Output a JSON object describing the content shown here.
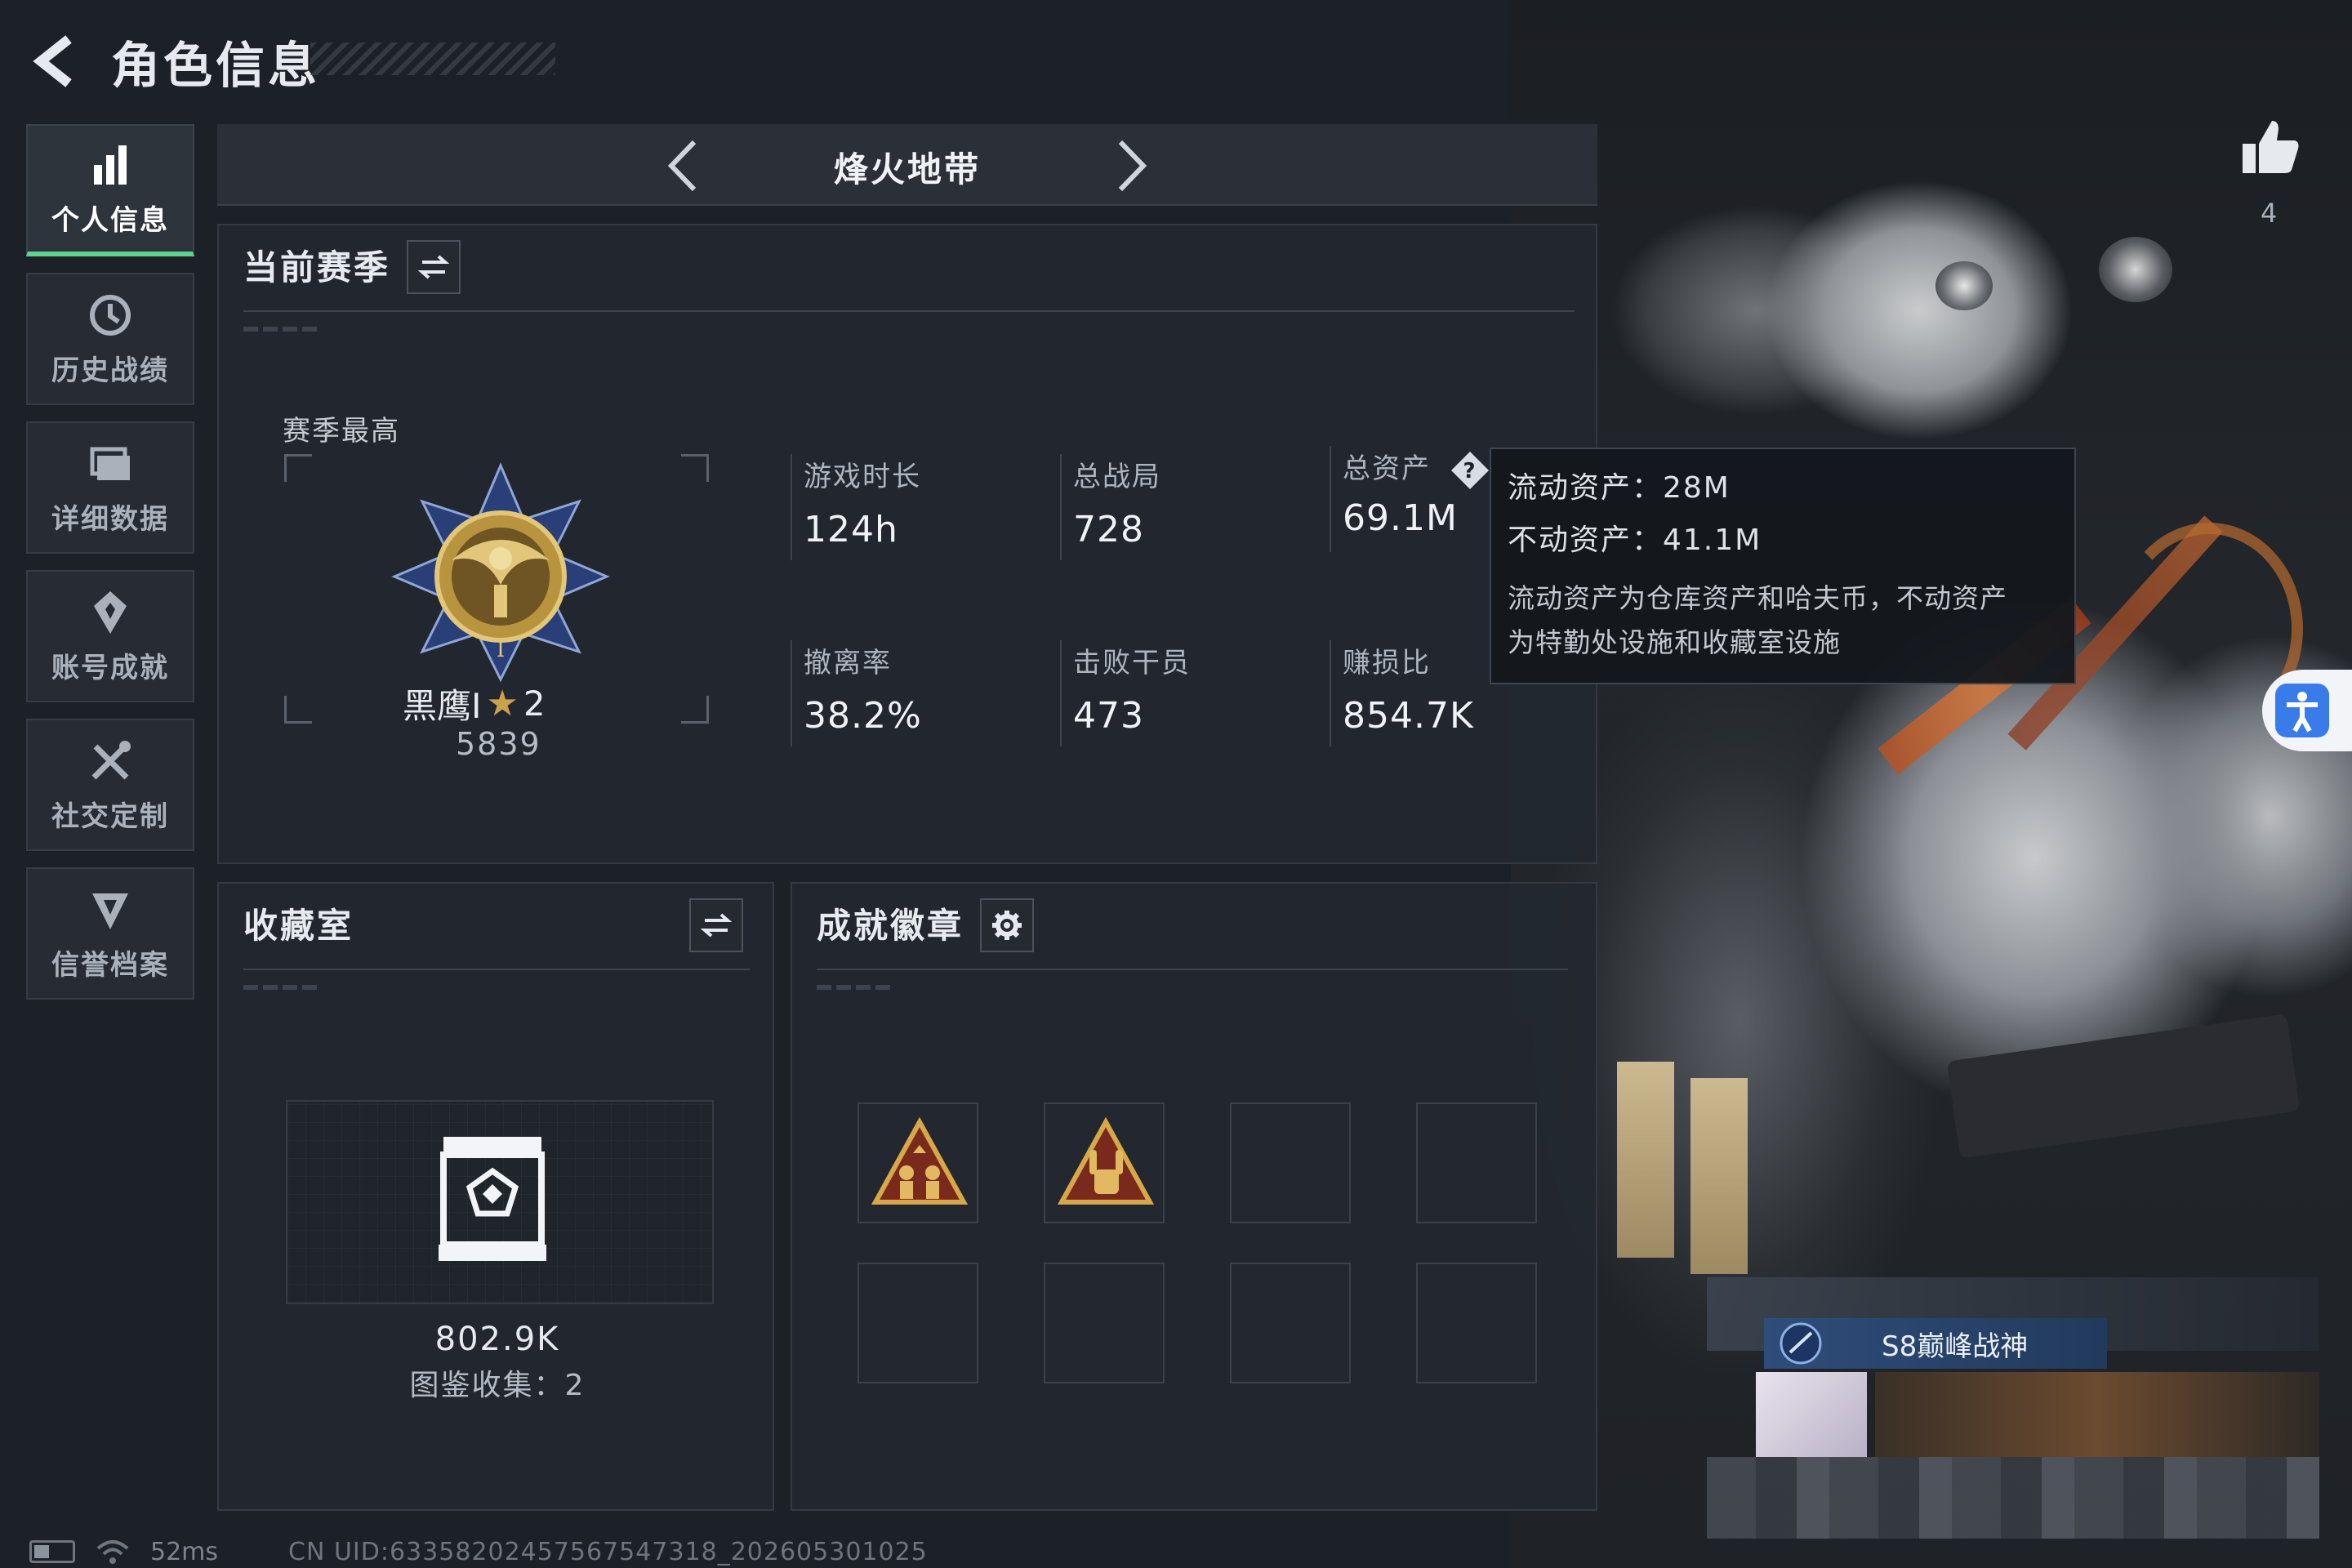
{
  "header": {
    "title": "角色信息"
  },
  "sidebar": {
    "items": [
      {
        "label": "个人信息",
        "icon": "bar-chart-icon",
        "active": true
      },
      {
        "label": "历史战绩",
        "icon": "history-icon"
      },
      {
        "label": "详细数据",
        "icon": "folder-icon"
      },
      {
        "label": "账号成就",
        "icon": "achievement-icon"
      },
      {
        "label": "社交定制",
        "icon": "tools-icon"
      },
      {
        "label": "信誉档案",
        "icon": "shield-icon"
      }
    ]
  },
  "mode": {
    "label": "烽火地带"
  },
  "season": {
    "title": "当前赛季",
    "best_label": "赛季最高",
    "rank_name": "黑鹰I",
    "rank_stars": "2",
    "rank_score": "5839",
    "stats": {
      "playtime": {
        "label": "游戏时长",
        "value": "124h"
      },
      "matches": {
        "label": "总战局",
        "value": "728"
      },
      "assets": {
        "label": "总资产",
        "value": "69.1M"
      },
      "extract_rate": {
        "label": "撤离率",
        "value": "38.2%"
      },
      "kills": {
        "label": "击败干员",
        "value": "473"
      },
      "profit": {
        "label": "赚损比",
        "value": "854.7K"
      }
    }
  },
  "tooltip": {
    "liquid": "流动资产：28M",
    "fixed": "不动资产：41.1M",
    "desc_line1": "流动资产为仓库资产和哈夫币，不动资产",
    "desc_line2": "为特勤处设施和收藏室设施"
  },
  "collection": {
    "title": "收藏室",
    "value": "802.9K",
    "count_text": "图鉴收集：2"
  },
  "badges": {
    "title": "成就徽章",
    "filled": 2,
    "total_slots": 8
  },
  "likes": {
    "count": "4"
  },
  "profile": {
    "title_badge": "S8巅峰战神"
  },
  "footer": {
    "ping": "52ms",
    "uid": "CN UID:6335820245756754731​8_202605301025"
  },
  "colors": {
    "accent_green": "#5ed38f",
    "gold": "#c9a24a",
    "panel_bg": "#232830"
  }
}
